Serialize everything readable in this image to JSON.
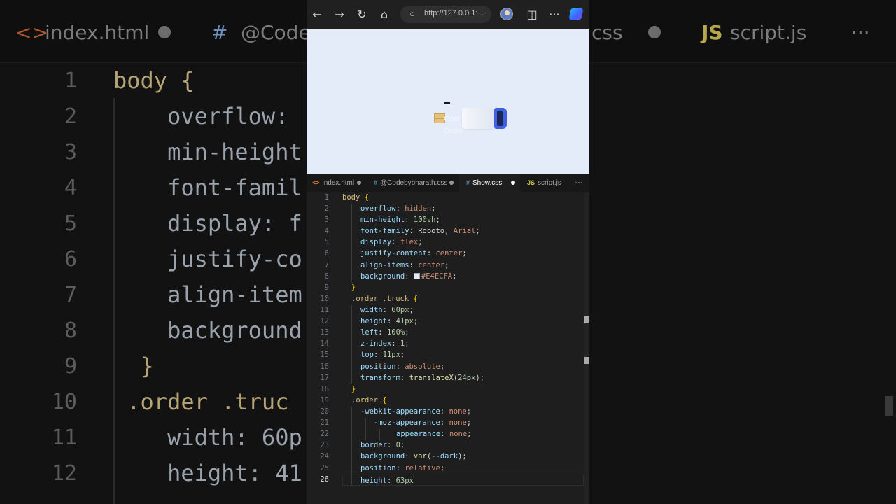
{
  "background_editor": {
    "tabs": [
      {
        "icon": "<>",
        "label": "index.html"
      },
      {
        "icon": "#",
        "label": "@Code"
      },
      {
        "icon": "",
        "label": "css"
      },
      {
        "icon": "JS",
        "label": "script.js"
      }
    ],
    "more": "···",
    "line_numbers": [
      "1",
      "2",
      "3",
      "4",
      "5",
      "6",
      "7",
      "8",
      "9",
      "10",
      "11",
      "12"
    ],
    "lines": [
      "body {",
      "    overflow:",
      "    min-height",
      "    font-famil",
      "    display: f",
      "    justify-co",
      "    align-item",
      "    background",
      "  }",
      " .order .truc",
      "    width: 60p",
      "    height: 41"
    ]
  },
  "browser": {
    "url": "http://127.0.0.1:..."
  },
  "preview": {
    "order_label_line1": "Com",
    "order_label_line2": "Order"
  },
  "editor": {
    "tabs": [
      {
        "icon": "<>",
        "label": "index.html",
        "modified": true,
        "active": false
      },
      {
        "icon": "#",
        "label": "@Codebybharath.css",
        "modified": true,
        "active": false
      },
      {
        "icon": "#",
        "label": "Show.css",
        "modified": true,
        "active": true
      },
      {
        "icon": "JS",
        "label": "script.js",
        "modified": false,
        "active": false
      }
    ],
    "more": "···",
    "current_line": 26,
    "line_numbers": [
      "1",
      "2",
      "3",
      "4",
      "5",
      "6",
      "7",
      "8",
      "9",
      "10",
      "11",
      "12",
      "13",
      "14",
      "15",
      "16",
      "17",
      "18",
      "19",
      "20",
      "21",
      "22",
      "23",
      "24",
      "25",
      "26"
    ],
    "code": {
      "l1_sel": "body",
      "l1_brace": "{",
      "l2_prop": "overflow",
      "l2_val": "hidden",
      "l3_prop": "min-height",
      "l3_val": "100vh",
      "l4_prop": "font-family",
      "l4_val1": "Roboto",
      "l4_val2": "Arial",
      "l5_prop": "display",
      "l5_val": "flex",
      "l6_prop": "justify-content",
      "l6_val": "center",
      "l7_prop": "align-items",
      "l7_val": "center",
      "l8_prop": "background",
      "l8_val": "#E4ECFA",
      "l9": "}",
      "l10_sel": ".order .truck",
      "l10_brace": "{",
      "l11_prop": "width",
      "l11_val": "60px",
      "l12_prop": "height",
      "l12_val": "41px",
      "l13_prop": "left",
      "l13_val": "100%",
      "l14_prop": "z-index",
      "l14_val": "1",
      "l15_prop": "top",
      "l15_val": "11px",
      "l16_prop": "position",
      "l16_val": "absolute",
      "l17_prop": "transform",
      "l17_fn": "translateX",
      "l17_val": "24px",
      "l18": "}",
      "l19_sel": ".order",
      "l19_brace": "{",
      "l20_prop": "-webkit-appearance",
      "l20_val": "none",
      "l21_prop": "-moz-appearance",
      "l21_val": "none",
      "l22_prop": "appearance",
      "l22_val": "none",
      "l23_prop": "border",
      "l23_val": "0",
      "l24_prop": "background",
      "l24_fn": "var",
      "l24_val": "--dark",
      "l25_prop": "position",
      "l25_val": "relative",
      "l26_prop": "height",
      "l26_val": "63px"
    }
  },
  "colors": {
    "preview_bg": "#E4ECFA",
    "truck_cab": "#3D5FE0",
    "editor_bg": "#1E1E1E"
  }
}
